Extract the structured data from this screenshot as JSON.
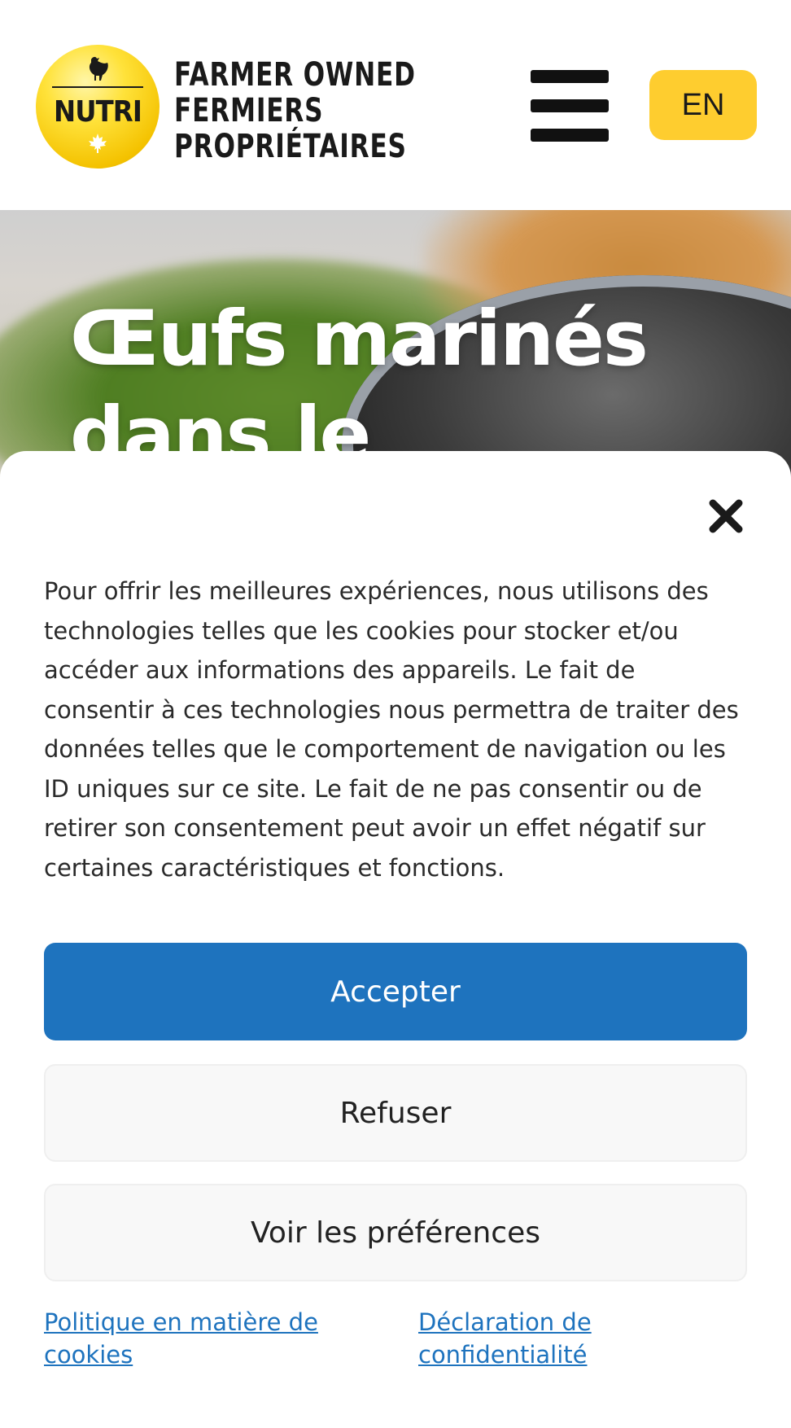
{
  "header": {
    "logo_text": "NUTRI",
    "tagline_lines": [
      "FARMER OWNED",
      "FERMIERS",
      "PROPRIÉTAIRES"
    ],
    "menu_icon": "hamburger-icon",
    "language_button": "EN",
    "colors": {
      "accent_yellow": "#fecd2f"
    }
  },
  "hero": {
    "title": "Œufs marinés dans le"
  },
  "cookie_banner": {
    "close_icon": "close-icon",
    "message": "Pour offrir les meilleures expériences, nous utilisons des technologies telles que les cookies pour stocker et/ou accéder aux informations des appareils. Le fait de consentir à ces technologies nous permettra de traiter des données telles que le comportement de navigation ou les ID uniques sur ce site. Le fait de ne pas consentir ou de retirer son consentement peut avoir un effet négatif sur certaines caractéristiques et fonctions.",
    "accept_label": "Accepter",
    "refuse_label": "Refuser",
    "preferences_label": "Voir les préférences",
    "cookie_policy_link": "Politique en matière de cookies",
    "privacy_link": "Déclaration de confidentialité",
    "colors": {
      "primary_blue": "#1e73be",
      "secondary_bg": "#f8f8f8"
    }
  }
}
